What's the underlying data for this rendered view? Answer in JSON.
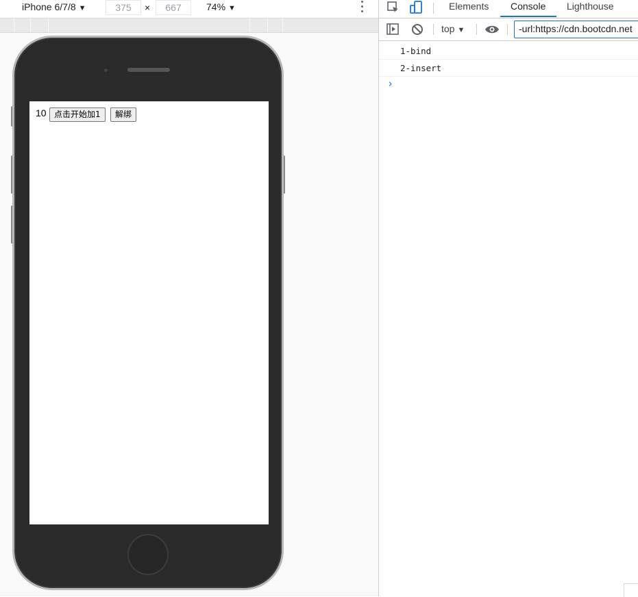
{
  "device_toolbar": {
    "device": "iPhone 6/7/8",
    "width": "375",
    "times": "×",
    "height": "667",
    "zoom": "74%",
    "caret": "▼"
  },
  "page": {
    "counter": "10",
    "start_button": "点击开始加1",
    "unbind_button": "解绑"
  },
  "devtools": {
    "tabs": [
      "Elements",
      "Console",
      "Lighthouse"
    ],
    "active_tab": "Console",
    "context": "top",
    "filter_value": "-url:https://cdn.bootcdn.net",
    "logs": [
      "1-bind",
      "2-insert"
    ],
    "prompt": "›",
    "accent_color": "#1a73e8"
  }
}
